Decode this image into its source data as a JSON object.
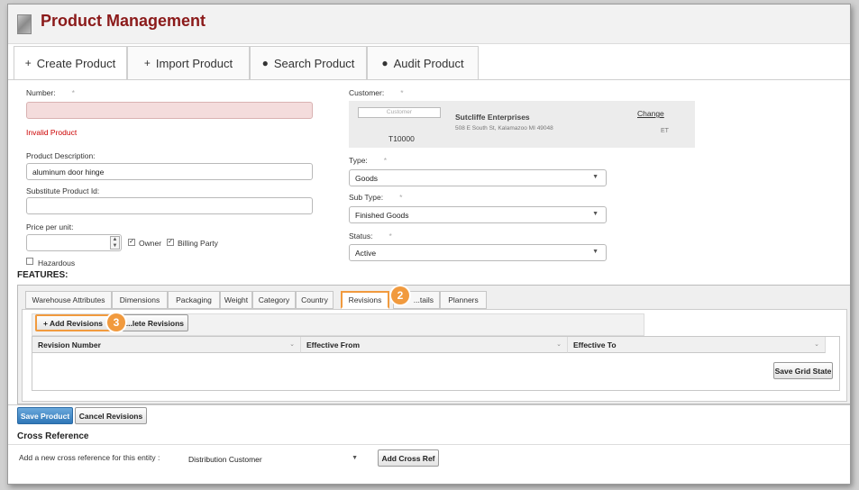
{
  "app_title": "Product Management",
  "tabs": [
    {
      "icon": "+",
      "label": "Create Product"
    },
    {
      "icon": "+",
      "label": "Import Product"
    },
    {
      "icon": "●",
      "label": "Search Product"
    },
    {
      "icon": "●",
      "label": "Audit Product"
    }
  ],
  "form": {
    "number_label": "Number:",
    "required_mark": "*",
    "number_value": "",
    "invalid_msg": "Invalid Product",
    "desc_label": "Product Description:",
    "desc_value": "aluminum door hinge",
    "substitute_label": "Substitute Product Id:",
    "substitute_value": "",
    "price_label": "Price per unit:",
    "price_value": "",
    "owner_label": "Owner",
    "billing_label": "Billing Party",
    "hazardous_label": "Hazardous",
    "customer_label": "Customer:",
    "customer_placeholder": "Customer",
    "customer_name": "Sutcliffe Enterprises",
    "customer_address": "508 E South St, Kalamazoo MI 49048",
    "customer_id": "T10000",
    "customer_change": "Change",
    "customer_tz": "ET",
    "type_label": "Type:",
    "type_value": "Goods",
    "subtype_label": "Sub Type:",
    "subtype_value": "Finished Goods",
    "status_label": "Status:",
    "status_value": "Active"
  },
  "features": {
    "title": "FEATURES:",
    "tabs": [
      "Warehouse Attributes",
      "Dimensions",
      "Packaging",
      "Weight",
      "Category",
      "Country",
      "Revisions",
      "...tails",
      "Planners"
    ],
    "add_revisions": "+ Add Revisions",
    "delete_revisions": "...lete Revisions",
    "columns": [
      "Revision Number",
      "Effective From",
      "Effective To"
    ],
    "save_grid_state": "Save Grid State",
    "badge_2": "2",
    "badge_3": "3"
  },
  "actions": {
    "save": "Save Product",
    "cancel": "Cancel Revisions"
  },
  "cross_ref": {
    "title": "Cross Reference",
    "prompt": "Add a new cross reference for this entity :",
    "select_value": "Distribution Customer",
    "add_button": "Add Cross Ref"
  },
  "colors": {
    "title": "#8b1a1a",
    "accent": "#f19a3e",
    "primary": "#2f77b8",
    "error": "#cc0000"
  }
}
